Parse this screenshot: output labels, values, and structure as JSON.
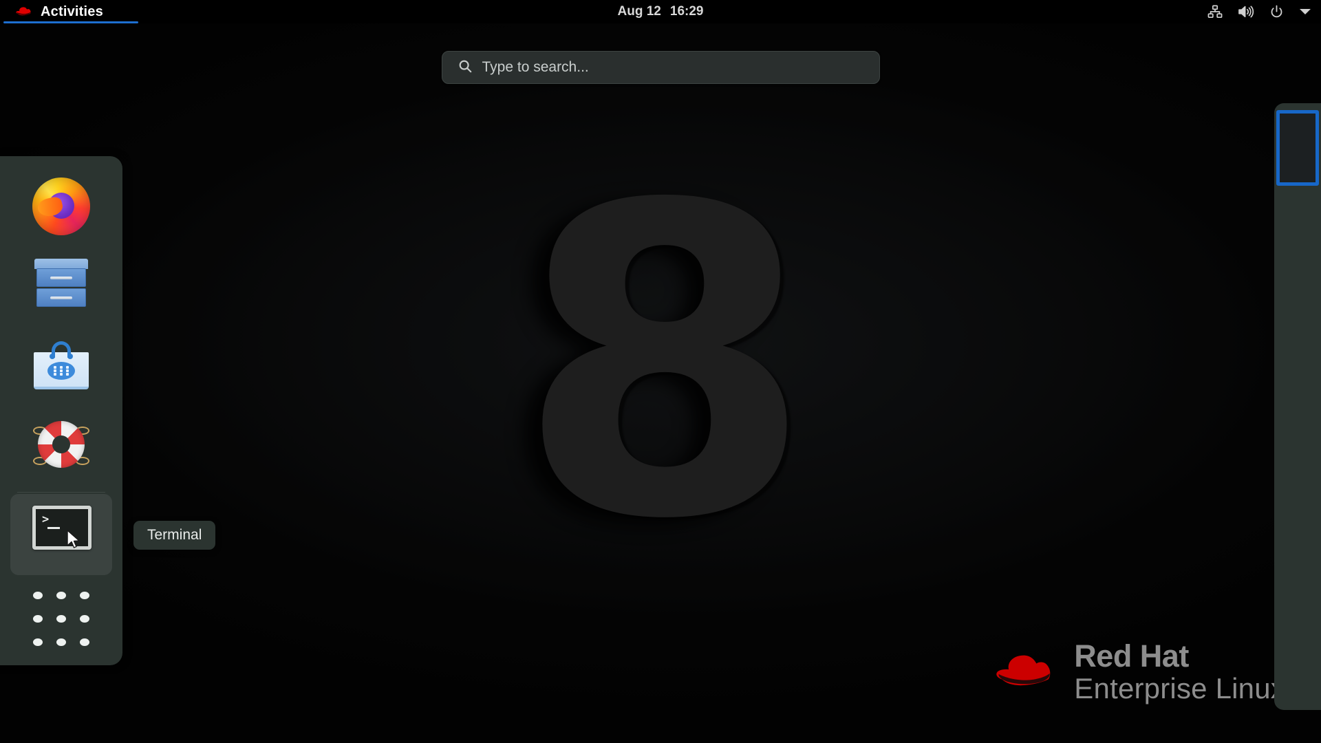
{
  "topbar": {
    "activities_label": "Activities",
    "activities_icon": "redhat-logo-icon",
    "clock": {
      "date": "Aug 12",
      "time": "16:29"
    },
    "status_icons": [
      {
        "name": "network-wired-icon"
      },
      {
        "name": "volume-speaker-icon"
      },
      {
        "name": "power-icon"
      },
      {
        "name": "chevron-down-icon"
      }
    ],
    "accent_color": "#1d6fd0"
  },
  "search": {
    "placeholder": "Type to search...",
    "icon": "search-icon",
    "value": ""
  },
  "dock": {
    "background_color": "#2b3430",
    "items": [
      {
        "name": "firefox",
        "label": "Firefox",
        "icon": "firefox-icon"
      },
      {
        "name": "files",
        "label": "Files",
        "icon": "files-cabinet-icon"
      },
      {
        "name": "software",
        "label": "Software",
        "icon": "software-bag-icon"
      },
      {
        "name": "help",
        "label": "Help",
        "icon": "lifebuoy-icon"
      },
      {
        "name": "terminal",
        "label": "Terminal",
        "icon": "terminal-icon",
        "hovered": true
      }
    ],
    "show_applications": {
      "label": "Show Applications",
      "icon": "apps-grid-icon"
    },
    "tooltip": "Terminal"
  },
  "workspaces": {
    "background_color": "#2b3430",
    "active_border_color": "#1767c8",
    "thumbnails": [
      {
        "name": "workspace-1",
        "active": true
      }
    ]
  },
  "wallpaper": {
    "glyph": "8",
    "brand_line1": "Red Hat",
    "brand_line2": "Enterprise Linux",
    "hat_color": "#cc0000"
  }
}
